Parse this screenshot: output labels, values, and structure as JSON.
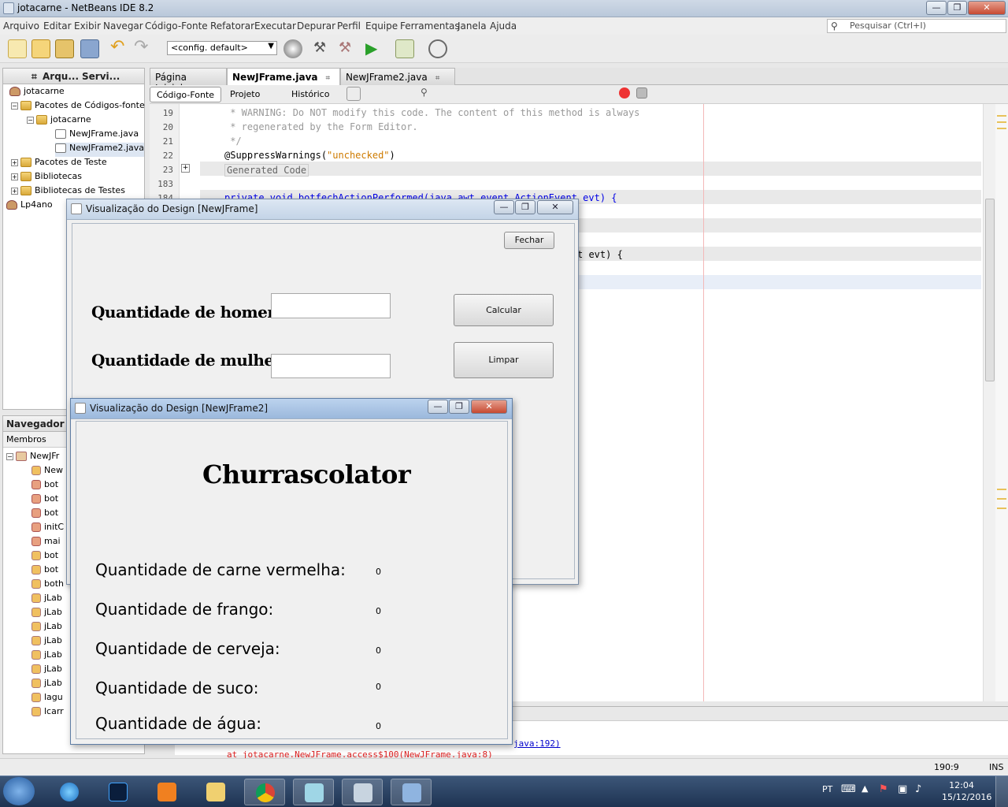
{
  "window": {
    "title": "jotacarne - NetBeans IDE 8.2"
  },
  "menu": [
    "Arquivo",
    "Editar",
    "Exibir",
    "Navegar",
    "Código-Fonte",
    "Refatorar",
    "Executar",
    "Depurar",
    "Perfil",
    "Equipe",
    "Ferramentas",
    "Janela",
    "Ajuda"
  ],
  "search": {
    "placeholder": "Pesquisar (Ctrl+I)"
  },
  "toolbar": {
    "config": "<config. default>"
  },
  "projects": {
    "tabs": [
      "Arqu...",
      "Servi..."
    ],
    "tree": [
      {
        "label": "jotacarne"
      },
      {
        "label": "Pacotes de Códigos-fonte"
      },
      {
        "label": "jotacarne"
      },
      {
        "label": "NewJFrame.java"
      },
      {
        "label": "NewJFrame2.java"
      },
      {
        "label": "Pacotes de Teste"
      },
      {
        "label": "Bibliotecas"
      },
      {
        "label": "Bibliotecas de Testes"
      },
      {
        "label": "Lp4ano"
      }
    ]
  },
  "navigator": {
    "title": "Navegador",
    "members": "Membros",
    "root": "NewJFr",
    "items": [
      "New",
      "bot",
      "bot",
      "bot",
      "initC",
      "mai",
      "bot",
      "bot",
      "both",
      "jLab",
      "jLab",
      "jLab",
      "jLab",
      "jLab",
      "jLab",
      "jLab",
      "lagu",
      "lcarr"
    ]
  },
  "editor": {
    "tabs": [
      {
        "label": "Página Inicial"
      },
      {
        "label": "NewJFrame.java"
      },
      {
        "label": "NewJFrame2.java"
      }
    ],
    "views": [
      "Código-Fonte",
      "Projeto",
      "Histórico"
    ],
    "lines": [
      {
        "num": "19",
        "text": " * WARNING: Do NOT modify this code. The content of this method is always"
      },
      {
        "num": "20",
        "text": " * regenerated by the Form Editor."
      },
      {
        "num": "21",
        "text": " */"
      },
      {
        "num": "22",
        "prefix": "@SuppressWarnings(",
        "str": "\"unchecked\"",
        "suffix": ")"
      },
      {
        "num": "23",
        "text": "Generated Code"
      },
      {
        "num": "183",
        "text": ""
      },
      {
        "num": "184",
        "text": "private void botfechActionPerformed(java.awt.event.ActionEvent evt) {"
      }
    ],
    "partial_line": "t evt) {"
  },
  "output": {
    "line1_link": "java:192)",
    "line2": "at jotacarne.NewJFrame.access$100(NewJFrame.java:8)"
  },
  "status": {
    "position": "190:9",
    "mode": "INS"
  },
  "design1": {
    "title": "Visualização do Design [NewJFrame]",
    "close_btn": "Fechar",
    "label_men": "Quantidade de homens:",
    "label_women": "Quantidade de mulheres:",
    "calc_btn": "Calcular",
    "clear_btn": "Limpar",
    "men_value": "",
    "women_value": ""
  },
  "design2": {
    "title": "Visualização do Design [NewJFrame2]",
    "heading": "Churrascolator",
    "rows": [
      {
        "label": "Quantidade de carne vermelha:",
        "value": "0"
      },
      {
        "label": "Quantidade de frango:",
        "value": "0"
      },
      {
        "label": "Quantidade de cerveja:",
        "value": "0"
      },
      {
        "label": "Quantidade de suco:",
        "value": "0"
      },
      {
        "label": "Quantidade de água:",
        "value": "0"
      }
    ]
  },
  "taskbar": {
    "lang": "PT",
    "time": "12:04",
    "date": "15/12/2016"
  }
}
